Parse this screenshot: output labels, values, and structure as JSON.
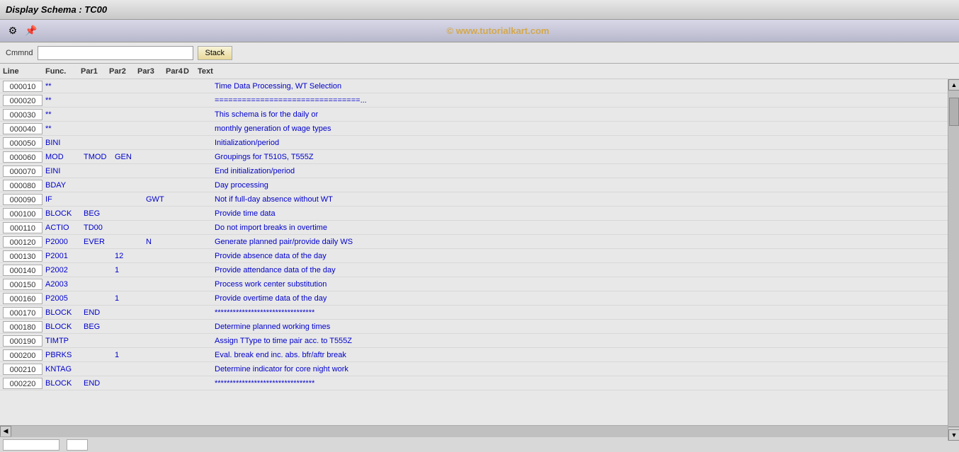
{
  "title_bar": {
    "label": "Display Schema : TC00"
  },
  "watermark": {
    "text": "© www.tutorialkart.com"
  },
  "toolbar": {
    "icons": [
      {
        "name": "settings-icon",
        "symbol": "⚙"
      },
      {
        "name": "pin-icon",
        "symbol": "📌"
      }
    ]
  },
  "command_bar": {
    "label": "Cmmnd",
    "input_value": "",
    "stack_button": "Stack"
  },
  "columns": {
    "line": "Line",
    "func": "Func.",
    "par1": "Par1",
    "par2": "Par2",
    "par3": "Par3",
    "par4": "Par4",
    "d": "D",
    "text": "Text"
  },
  "rows": [
    {
      "line": "000010",
      "func": "**",
      "par1": "",
      "par2": "",
      "par3": "",
      "par4": "",
      "d": "",
      "text": "Time Data Processing, WT Selection"
    },
    {
      "line": "000020",
      "func": "**",
      "par1": "",
      "par2": "",
      "par3": "",
      "par4": "",
      "d": "",
      "text": "================================..."
    },
    {
      "line": "000030",
      "func": "**",
      "par1": "",
      "par2": "",
      "par3": "",
      "par4": "",
      "d": "",
      "text": "This schema is for the daily or"
    },
    {
      "line": "000040",
      "func": "**",
      "par1": "",
      "par2": "",
      "par3": "",
      "par4": "",
      "d": "",
      "text": "monthly generation of wage types"
    },
    {
      "line": "000050",
      "func": "BINI",
      "par1": "",
      "par2": "",
      "par3": "",
      "par4": "",
      "d": "",
      "text": "Initialization/period"
    },
    {
      "line": "000060",
      "func": "MOD",
      "par1": "TMOD",
      "par2": "GEN",
      "par3": "",
      "par4": "",
      "d": "",
      "text": "Groupings for T510S, T555Z"
    },
    {
      "line": "000070",
      "func": "EINI",
      "par1": "",
      "par2": "",
      "par3": "",
      "par4": "",
      "d": "",
      "text": "End initialization/period"
    },
    {
      "line": "000080",
      "func": "BDAY",
      "par1": "",
      "par2": "",
      "par3": "",
      "par4": "",
      "d": "",
      "text": "Day processing"
    },
    {
      "line": "000090",
      "func": "IF",
      "par1": "",
      "par2": "",
      "par3": "GWT",
      "par4": "",
      "d": "",
      "text": "Not if full-day absence without WT"
    },
    {
      "line": "000100",
      "func": "BLOCK",
      "par1": "BEG",
      "par2": "",
      "par3": "",
      "par4": "",
      "d": "",
      "text": "Provide time data"
    },
    {
      "line": "000110",
      "func": "ACTIO",
      "par1": "TD00",
      "par2": "",
      "par3": "",
      "par4": "",
      "d": "",
      "text": "Do not import breaks in overtime"
    },
    {
      "line": "000120",
      "func": "P2000",
      "par1": "EVER",
      "par2": "",
      "par3": "N",
      "par4": "",
      "d": "",
      "text": "Generate planned pair/provide daily WS"
    },
    {
      "line": "000130",
      "func": "P2001",
      "par1": "",
      "par2": "12",
      "par3": "",
      "par4": "",
      "d": "",
      "text": "Provide absence data of the day"
    },
    {
      "line": "000140",
      "func": "P2002",
      "par1": "",
      "par2": "1",
      "par3": "",
      "par4": "",
      "d": "",
      "text": "Provide attendance data of the day"
    },
    {
      "line": "000150",
      "func": "A2003",
      "par1": "",
      "par2": "",
      "par3": "",
      "par4": "",
      "d": "",
      "text": "Process work center substitution"
    },
    {
      "line": "000160",
      "func": "P2005",
      "par1": "",
      "par2": "1",
      "par3": "",
      "par4": "",
      "d": "",
      "text": "Provide overtime data of the day"
    },
    {
      "line": "000170",
      "func": "BLOCK",
      "par1": "END",
      "par2": "",
      "par3": "",
      "par4": "",
      "d": "",
      "text": "*********************************"
    },
    {
      "line": "000180",
      "func": "BLOCK",
      "par1": "BEG",
      "par2": "",
      "par3": "",
      "par4": "",
      "d": "",
      "text": "Determine planned working times"
    },
    {
      "line": "000190",
      "func": "TIMTP",
      "par1": "",
      "par2": "",
      "par3": "",
      "par4": "",
      "d": "",
      "text": "Assign TType to time pair acc. to T555Z"
    },
    {
      "line": "000200",
      "func": "PBRKS",
      "par1": "",
      "par2": "1",
      "par3": "",
      "par4": "",
      "d": "",
      "text": "Eval. break end inc. abs. bfr/aftr break"
    },
    {
      "line": "000210",
      "func": "KNTAG",
      "par1": "",
      "par2": "",
      "par3": "",
      "par4": "",
      "d": "",
      "text": "Determine indicator for core night work"
    },
    {
      "line": "000220",
      "func": "BLOCK",
      "par1": "END",
      "par2": "",
      "par3": "",
      "par4": "",
      "d": "",
      "text": "*********************************"
    }
  ]
}
